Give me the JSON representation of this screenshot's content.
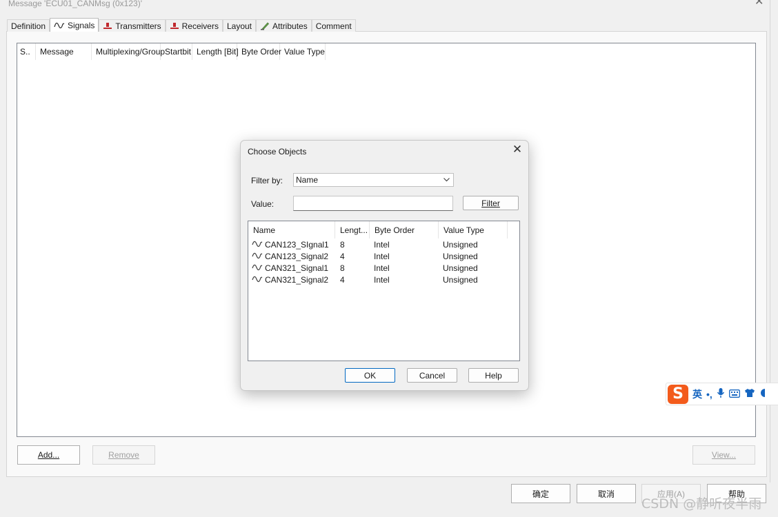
{
  "window": {
    "title": "Message 'ECU01_CANMsg (0x123)'"
  },
  "tabs": [
    {
      "label": "Definition",
      "icon": "none"
    },
    {
      "label": "Signals",
      "icon": "signal-wave-icon"
    },
    {
      "label": "Transmitters",
      "icon": "node-icon"
    },
    {
      "label": "Receivers",
      "icon": "node-icon"
    },
    {
      "label": "Layout",
      "icon": "none"
    },
    {
      "label": "Attributes",
      "icon": "attribute-pencil-icon"
    },
    {
      "label": "Comment",
      "icon": "none"
    }
  ],
  "signals_list": {
    "columns": [
      "S..",
      "Message",
      "Multiplexing/Group",
      "Startbit",
      "Length [Bit]",
      "Byte Order",
      "Value Type"
    ]
  },
  "panel_buttons": {
    "add": "Add...",
    "remove": "Remove",
    "view": "View..."
  },
  "footer_buttons": {
    "ok": "确定",
    "cancel": "取消",
    "apply": "应用(A)",
    "help": "帮助"
  },
  "dialog": {
    "title": "Choose Objects",
    "filter_by_label": "Filter by:",
    "filter_by_value": "Name",
    "value_label": "Value:",
    "value_input": "",
    "filter_button": "Filter",
    "columns": [
      "Name",
      "Lengt...",
      "Byte Order",
      "Value Type"
    ],
    "rows": [
      {
        "name": "CAN123_SIgnal1",
        "length": "8",
        "byte_order": "Intel",
        "value_type": "Unsigned"
      },
      {
        "name": "CAN123_Signal2",
        "length": "4",
        "byte_order": "Intel",
        "value_type": "Unsigned"
      },
      {
        "name": "CAN321_Signal1",
        "length": "8",
        "byte_order": "Intel",
        "value_type": "Unsigned"
      },
      {
        "name": "CAN321_Signal2",
        "length": "4",
        "byte_order": "Intel",
        "value_type": "Unsigned"
      }
    ],
    "ok_button": "OK",
    "cancel_button": "Cancel",
    "help_button": "Help"
  },
  "ime_toolbar": {
    "logo": "S",
    "mode": "英",
    "punct": "•,"
  },
  "watermark": "CSDN @静听夜半雨",
  "colors": {
    "accent": "#0067c0",
    "node_icon_red": "#c0282d",
    "ime_orange": "#f35b1c",
    "ime_blue": "#1565c0"
  }
}
